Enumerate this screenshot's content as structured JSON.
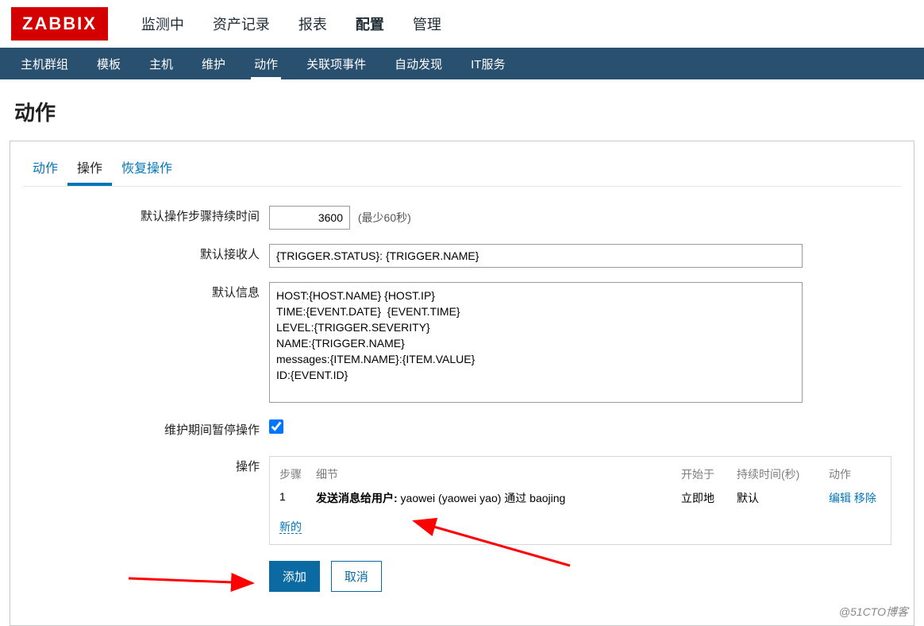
{
  "brand": "ZABBIX",
  "top_nav": [
    "监测中",
    "资产记录",
    "报表",
    "配置",
    "管理"
  ],
  "top_nav_active": 3,
  "sub_nav": [
    "主机群组",
    "模板",
    "主机",
    "维护",
    "动作",
    "关联项事件",
    "自动发现",
    "IT服务"
  ],
  "sub_nav_active": 4,
  "page_title": "动作",
  "tabs": [
    "动作",
    "操作",
    "恢复操作"
  ],
  "tabs_active": 1,
  "form": {
    "f1_label": "默认操作步骤持续时间",
    "f1_value": "3600",
    "f1_hint": "(最少60秒)",
    "f2_label": "默认接收人",
    "f2_value": "{TRIGGER.STATUS}: {TRIGGER.NAME}",
    "f3_label": "默认信息",
    "f3_value": "HOST:{HOST.NAME} {HOST.IP}\nTIME:{EVENT.DATE}  {EVENT.TIME}\nLEVEL:{TRIGGER.SEVERITY}\nNAME:{TRIGGER.NAME}\nmessages:{ITEM.NAME}:{ITEM.VALUE}\nID:{EVENT.ID}",
    "f4_label": "维护期间暂停操作",
    "f4_checked": true,
    "f5_label": "操作"
  },
  "ops": {
    "hd_step": "步骤",
    "hd_detail": "细节",
    "hd_start": "开始于",
    "hd_dur": "持续时间(秒)",
    "hd_act": "动作",
    "row": {
      "step": "1",
      "detail_b": "发送消息给用户:",
      "detail_t": " yaowei (yaowei yao) 通过 baojing",
      "start": "立即地",
      "dur": "默认",
      "edit": "编辑",
      "remove": "移除"
    },
    "new": "新的"
  },
  "buttons": {
    "add": "添加",
    "cancel": "取消"
  },
  "watermark": "@51CTO博客"
}
